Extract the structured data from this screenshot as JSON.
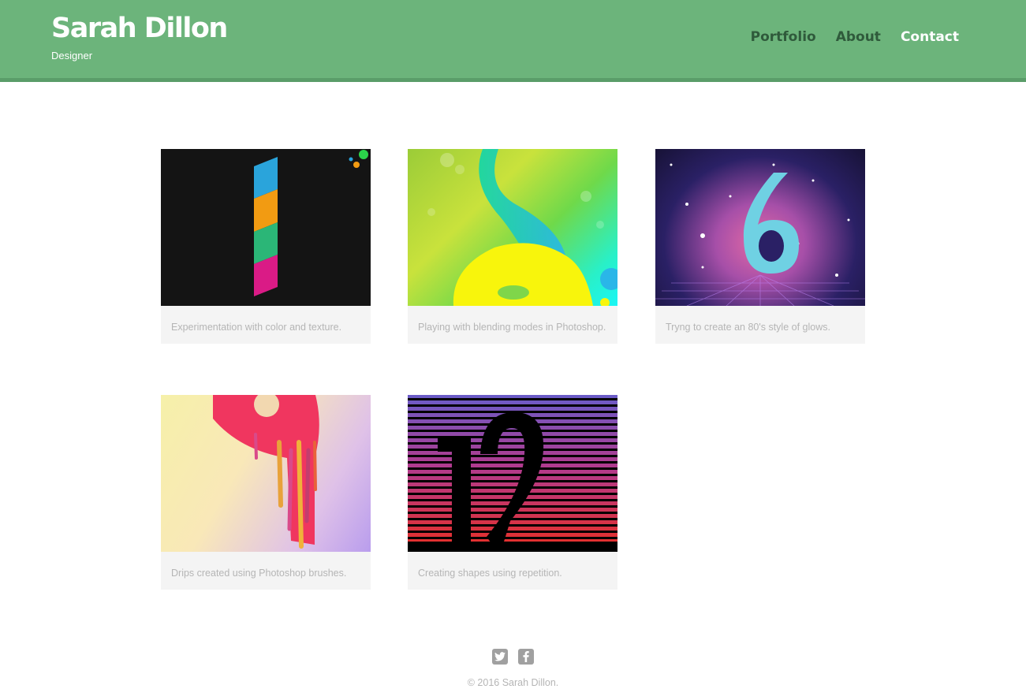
{
  "header": {
    "name": "Sarah Dillon",
    "tagline": "Designer",
    "nav": [
      {
        "label": "Portfolio"
      },
      {
        "label": "About"
      },
      {
        "label": "Contact"
      }
    ],
    "active_nav": "Contact"
  },
  "portfolio": {
    "items": [
      {
        "caption": "Experimentation with color and texture.",
        "thumbnail": "number-1-artwork"
      },
      {
        "caption": "Playing with blending modes in Photoshop.",
        "thumbnail": "number-8-artwork"
      },
      {
        "caption": "Tryng to create an 80's style of glows.",
        "thumbnail": "number-6-artwork"
      },
      {
        "caption": "Drips created using Photoshop brushes.",
        "thumbnail": "number-9-artwork"
      },
      {
        "caption": "Creating shapes using repetition.",
        "thumbnail": "number-12-artwork"
      }
    ]
  },
  "footer": {
    "social": [
      {
        "icon": "twitter-icon"
      },
      {
        "icon": "facebook-icon"
      }
    ],
    "copyright": "© 2016 Sarah Dillon."
  },
  "colors": {
    "header_bg": "#6cb47b",
    "header_border": "#5a9d69",
    "nav_text": "#2f5a3b",
    "nav_active": "#ffffff",
    "caption_bg": "#f4f4f4",
    "caption_text": "#b5b5b5"
  }
}
